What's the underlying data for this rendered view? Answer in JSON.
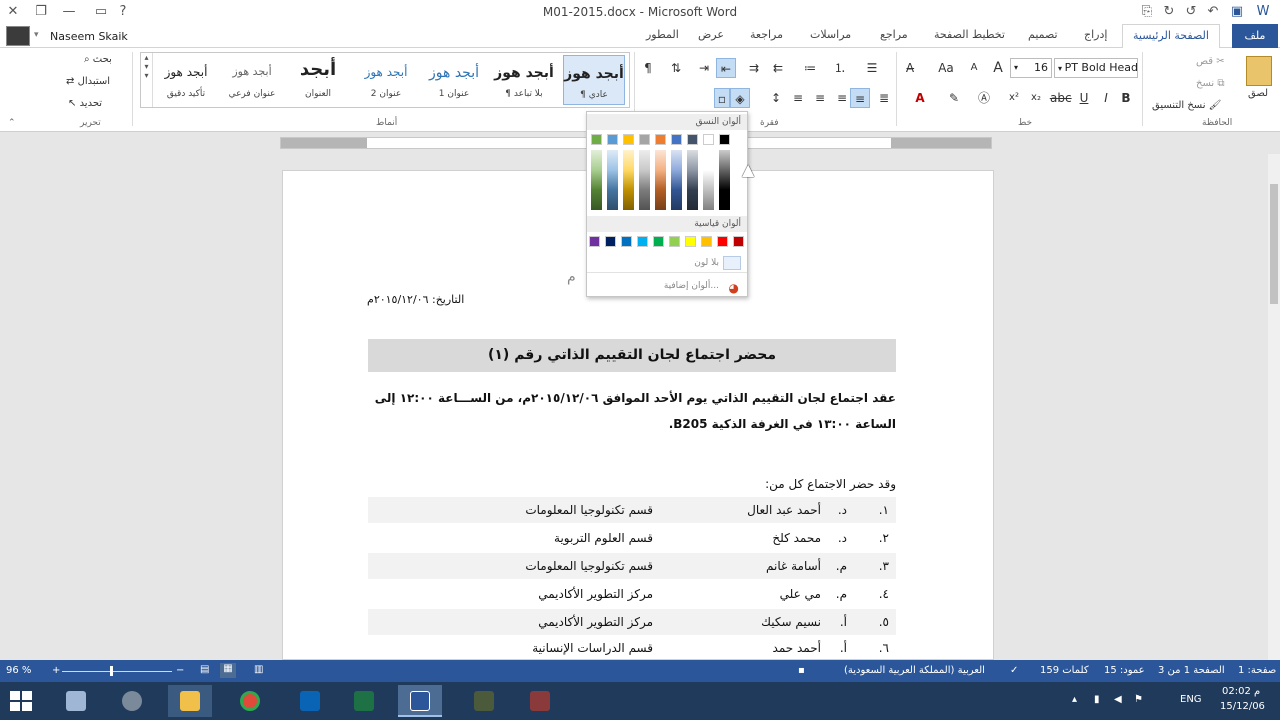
{
  "window": {
    "title": "M01-2015.docx - Microsoft Word",
    "help": "?",
    "minimize": "—",
    "restore": "❐",
    "close": "✕"
  },
  "quick_access": {
    "save_icon": "save-icon",
    "undo_icon": "undo-icon",
    "redo_icon": "redo-icon"
  },
  "user": {
    "name": "Naseem Skaik"
  },
  "tabs": [
    {
      "label": "ملف",
      "key": "file"
    },
    {
      "label": "الصفحة الرئيسية",
      "key": "home"
    },
    {
      "label": "إدراج",
      "key": "insert"
    },
    {
      "label": "تصميم",
      "key": "design"
    },
    {
      "label": "تخطيط الصفحة",
      "key": "layout"
    },
    {
      "label": "مراجع",
      "key": "references"
    },
    {
      "label": "مراسلات",
      "key": "mailings"
    },
    {
      "label": "مراجعة",
      "key": "review"
    },
    {
      "label": "عرض",
      "key": "view"
    },
    {
      "label": "المطور",
      "key": "developer"
    }
  ],
  "ribbon": {
    "clipboard": {
      "group_label": "الحافظة",
      "paste": "لصق",
      "cut": "قص",
      "copy": "نسخ",
      "format_painter": "نسخ التنسيق"
    },
    "font": {
      "group_label": "خط",
      "font_name": "PT Bold Head",
      "font_size": "16",
      "bold": "B",
      "italic": "I",
      "underline": "U",
      "subscript": "x₂",
      "superscript": "x²",
      "grow": "A",
      "shrink": "A",
      "change_case": "Aa"
    },
    "paragraph": {
      "group_label": "فقرة"
    },
    "styles": {
      "group_label": "أنماط",
      "items": [
        {
          "preview": "أبجد هوز",
          "name": "¶ عادي"
        },
        {
          "preview": "أبجد هوز",
          "name": "¶ بلا تباعد"
        },
        {
          "preview": "أبجد هوز",
          "name": "عنوان 1"
        },
        {
          "preview": "أبجد هوز",
          "name": "عنوان 2"
        },
        {
          "preview": "أبجد",
          "name": "العنوان"
        },
        {
          "preview": "أبجد هوز",
          "name": "عنوان فرعي"
        },
        {
          "preview": "أبجد هوز",
          "name": "تأكيد دقيق"
        }
      ]
    },
    "editing": {
      "group_label": "تحرير",
      "find": "بحث",
      "replace": "استبدال",
      "select": "تحديد"
    }
  },
  "color_panel": {
    "theme_header": "ألوان النسق",
    "standard_header": "ألوان قياسية",
    "no_color": "بلا لون",
    "more_colors": "ألوان إضافية...",
    "theme_colors": [
      "#000000",
      "#ffffff",
      "#44546a",
      "#4472c4",
      "#ed7d31",
      "#a5a5a5",
      "#ffc000",
      "#5b9bd5",
      "#70ad47"
    ],
    "standard_colors": [
      "#c00000",
      "#ff0000",
      "#ffc000",
      "#ffff00",
      "#92d050",
      "#00b050",
      "#00b0f0",
      "#0070c0",
      "#002060",
      "#7030a0"
    ]
  },
  "document": {
    "date_line": "التاريخ: ٢٠١٥/١٢/٠٦م",
    "partial_header": "م",
    "heading": "محضر اجتماع لجان التقييم الذاتي رقم (١)",
    "paragraph_line1": "عقد اجتماع لجان التقييم الذاتي يوم الأحد الموافق ٢٠١٥/١٢/٠٦م، من الســـاعة ١٢:٠٠ إلى",
    "paragraph_line2": "الساعة ١٣:٠٠ في الغرفة الذكية B205.",
    "attendees_intro": "وقد حضر الاجتماع كل من:",
    "attendees": [
      {
        "num": "١.",
        "title": "د.",
        "name": "أحمد عبد العال",
        "dept": "قسم تكنولوجيا المعلومات"
      },
      {
        "num": "٢.",
        "title": "د.",
        "name": "محمد كلخ",
        "dept": "قسم العلوم التربوية"
      },
      {
        "num": "٣.",
        "title": "م.",
        "name": "أسامة غانم",
        "dept": "قسم تكنولوجيا المعلومات"
      },
      {
        "num": "٤.",
        "title": "م.",
        "name": "مي علي",
        "dept": "مركز التطوير الأكاديمي"
      },
      {
        "num": "٥.",
        "title": "أ.",
        "name": "نسيم سكيك",
        "dept": "مركز التطوير الأكاديمي"
      },
      {
        "num": "٦.",
        "title": "أ.",
        "name": "أحمد حمد",
        "dept": "قسم الدراسات الإنسانية"
      }
    ]
  },
  "statusbar": {
    "page": "صفحة: 1",
    "page_of": "الصفحة 1 من 3",
    "column": "عمود: 15",
    "words": "159 كلمات",
    "language": "العربية (المملكة العربية السعودية)",
    "zoom": "96 %"
  },
  "taskbar": {
    "lang": "ENG",
    "time": "02:02 م",
    "date": "15/12/06"
  },
  "colors": {
    "word_blue": "#2b579a",
    "taskbar": "#1f3a5a",
    "heading_shade": "#d9d9d9"
  }
}
